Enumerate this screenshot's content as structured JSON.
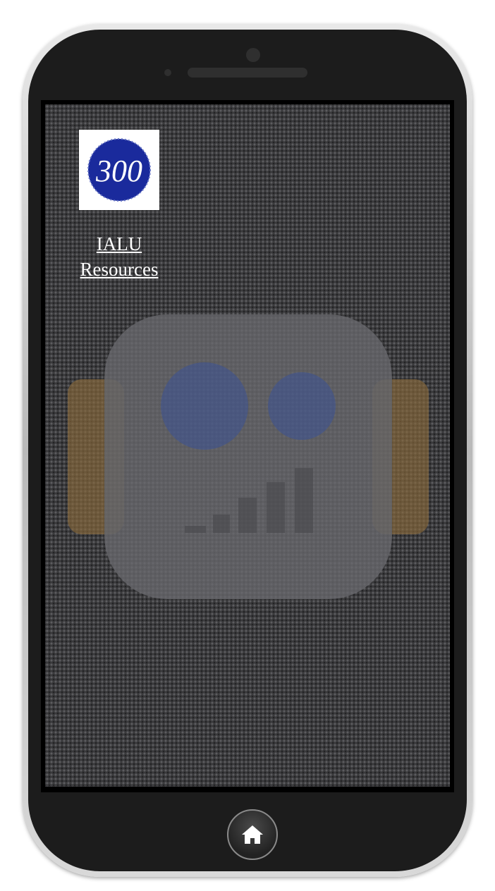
{
  "device": {
    "frame_color": "#1c1c1c",
    "bezel_color": "#c8c8c8"
  },
  "screen": {
    "background_color": "#3a3a3c",
    "wallpaper_icon": "robot-logo-icon"
  },
  "app": {
    "icon": "ialu-300-logo-icon",
    "icon_text": "300",
    "icon_color": "#1a2a9c",
    "label_line1": "IALU",
    "label_line2": "Resources"
  },
  "home_button": {
    "icon": "home-icon"
  }
}
